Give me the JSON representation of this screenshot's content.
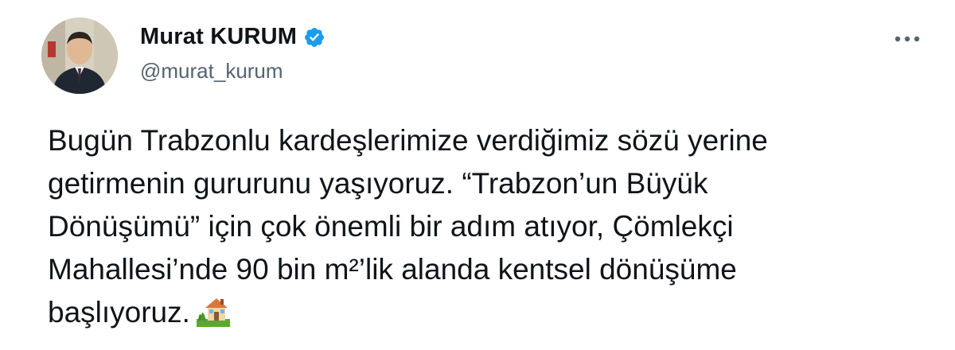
{
  "author": {
    "display_name": "Murat KURUM",
    "handle": "@murat_kurum",
    "verified": true,
    "verified_color": "#1d9bf0"
  },
  "more_menu": {
    "icon": "more-horizontal-icon"
  },
  "tweet": {
    "text": "Bugün Trabzonlu kardeşlerimize verdiğimiz sözü yerine\ngetirmenin gururunu yaşıyoruz. “Trabzon’un Büyük\nDönüşümü” için çok önemli bir adım atıyor, Çömlekçi\nMahallesi’nde 90 bin m²’lik alanda kentsel dönüşüme\nbaşlıyoruz.",
    "emoji": "house-with-garden-emoji"
  },
  "colors": {
    "text": "#0f1419",
    "secondary": "#536471",
    "accent": "#1d9bf0"
  }
}
